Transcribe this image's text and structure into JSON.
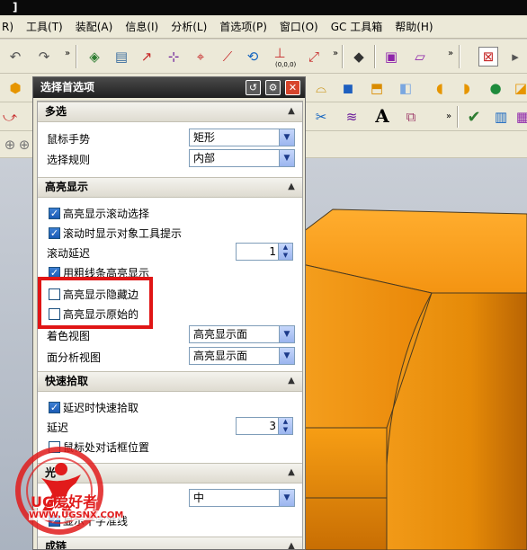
{
  "window": {
    "title_fragment": "]"
  },
  "menu": [
    {
      "label": "R)"
    },
    {
      "label": "工具(T)"
    },
    {
      "label": "装配(A)"
    },
    {
      "label": "信息(I)"
    },
    {
      "label": "分析(L)"
    },
    {
      "label": "首选项(P)"
    },
    {
      "label": "窗口(O)"
    },
    {
      "label": "GC 工具箱"
    },
    {
      "label": "帮助(H)"
    }
  ],
  "toolbar_text": {
    "coord_label": "(0,0,0)",
    "text_tool": "A"
  },
  "dialog": {
    "title": "选择首选项",
    "sections": {
      "multi": {
        "title": "多选",
        "mouse_gesture_label": "鼠标手势",
        "mouse_gesture_value": "矩形",
        "select_rule_label": "选择规则",
        "select_rule_value": "内部"
      },
      "highlight": {
        "title": "高亮显示",
        "rollover": "高亮显示滚动选择",
        "tooltip": "滚动时显示对象工具提示",
        "delay_label": "滚动延迟",
        "delay_value": "1",
        "thick": "用粗线条高亮显示",
        "hidden_edges": "高亮显示隐藏边",
        "original": "高亮显示原始的",
        "shaded_label": "着色视图",
        "shaded_value": "高亮显示面",
        "face_analysis_label": "面分析视图",
        "face_analysis_value": "高亮显示面"
      },
      "quickpick": {
        "title": "快速拾取",
        "delay_pick": "延迟时快速拾取",
        "delay_label": "延迟",
        "delay_value": "3",
        "dialog_pos": "鼠标处对话框位置"
      },
      "cursor": {
        "title": "光",
        "size_value": "中",
        "crosshair": "显示十字准线"
      },
      "chain": {
        "title": "成链"
      }
    }
  },
  "watermark": {
    "brand": "UG爱好者",
    "url": "WWW.UGSNX.COM"
  },
  "colors": {
    "highlight_box": "#e01515",
    "model_face": "#f59a1a",
    "dialog_title": "#2b2b2b"
  }
}
